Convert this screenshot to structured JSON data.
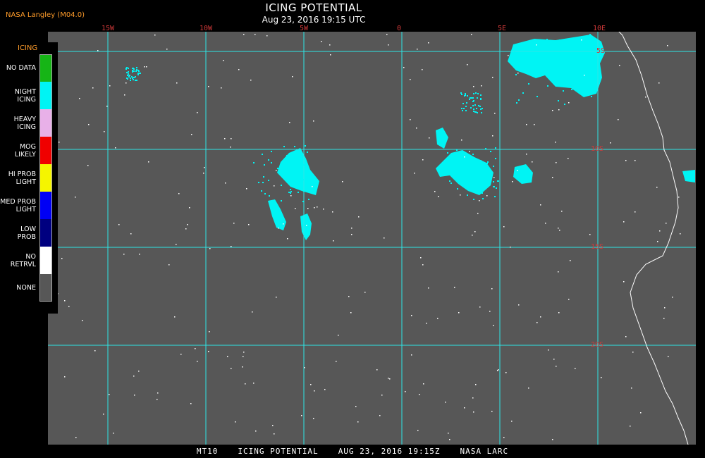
{
  "credit": "NASA Langley (M04.0)",
  "title": "ICING POTENTIAL",
  "subtitle": "Aug 23, 2016 19:15 UTC",
  "longitude_labels": [
    "15W",
    "10W",
    "5W",
    "0",
    "5E",
    "10E"
  ],
  "latitude_labels": [
    "5S",
    "10S",
    "15S",
    "20S"
  ],
  "legend": {
    "title": "ICING",
    "items": [
      {
        "label": "NO DATA",
        "color": "#16b516"
      },
      {
        "label": "NIGHT\nICING",
        "color": "#00f4f4"
      },
      {
        "label": "HEAVY\nICING",
        "color": "#e8b0e8"
      },
      {
        "label": "MOG\nLIKELY",
        "color": "#f00000"
      },
      {
        "label": "HI PROB\nLIGHT",
        "color": "#f5f500"
      },
      {
        "label": "MED PROB\nLIGHT",
        "color": "#0000f5"
      },
      {
        "label": "LOW\nPROB",
        "color": "#000080"
      },
      {
        "label": "NO\nRETRVL",
        "color": "#ffffff"
      },
      {
        "label": "NONE",
        "color": "#575757"
      }
    ]
  },
  "footer": {
    "sat": "MT10",
    "product": "ICING POTENTIAL",
    "datetime": "AUG 23, 2016 19:15Z",
    "org": "NASA LARC"
  },
  "colors": {
    "background": "#575757",
    "grid": "#2ee6e6",
    "coast": "#ffffff",
    "icing": "#00f4f4",
    "label_red": "#d23a3a"
  }
}
